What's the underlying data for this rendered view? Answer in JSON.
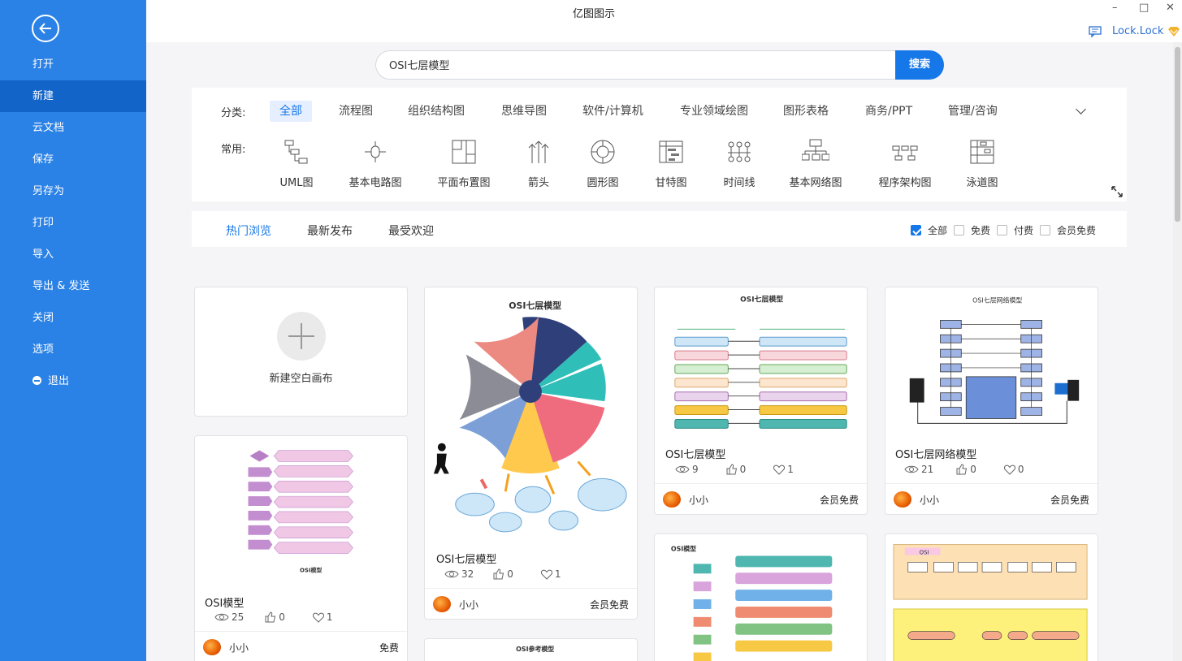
{
  "app_title": "亿图图示",
  "sidebar": {
    "items": [
      "打开",
      "新建",
      "云文档",
      "保存",
      "另存为",
      "打印",
      "导入",
      "导出 & 发送",
      "关闭",
      "选项",
      "退出"
    ],
    "active": "新建"
  },
  "window_controls": {
    "minimize": "–",
    "maximize": "□",
    "close": "✕"
  },
  "user": {
    "name": "Lock.Lock"
  },
  "search": {
    "value": "OSI七层模型",
    "button": "搜索"
  },
  "categories": {
    "label": "分类:",
    "items": [
      "全部",
      "流程图",
      "组织结构图",
      "思维导图",
      "软件/计算机",
      "专业领域绘图",
      "图形表格",
      "商务/PPT",
      "管理/咨询"
    ],
    "active": "全部"
  },
  "common": {
    "label": "常用:",
    "items": [
      "UML图",
      "基本电路图",
      "平面布置图",
      "箭头",
      "圆形图",
      "甘特图",
      "时间线",
      "基本网络图",
      "程序架构图",
      "泳道图"
    ]
  },
  "filter_tabs": [
    "热门浏览",
    "最新发布",
    "最受欢迎"
  ],
  "filter_checks": [
    {
      "label": "全部",
      "checked": true
    },
    {
      "label": "免费",
      "checked": false
    },
    {
      "label": "付费",
      "checked": false
    },
    {
      "label": "会员免费",
      "checked": false
    }
  ],
  "new_blank": {
    "label": "新建空白画布"
  },
  "cards": [
    {
      "title": "OSI七层模型",
      "views": "32",
      "likes": "0",
      "favorites": "1",
      "author": "小小",
      "price": "会员免费",
      "thumb_title": "OSI七层模型"
    },
    {
      "title": "OSI七层模型",
      "views": "9",
      "likes": "0",
      "favorites": "1",
      "author": "小小",
      "price": "会员免费",
      "thumb_title": "OSI七层模型"
    },
    {
      "title": "OSI七层网络模型",
      "views": "21",
      "likes": "0",
      "favorites": "0",
      "author": "小小",
      "price": "会员免费",
      "thumb_title": "OSI七层网络模型"
    },
    {
      "title": "OSI模型",
      "views": "25",
      "likes": "0",
      "favorites": "1",
      "author": "小小",
      "price": "免费",
      "thumb_title": "OSI模型"
    }
  ],
  "partial_cards": [
    {
      "thumb_title": "OSI参考模型"
    },
    {
      "thumb_title": "OSI模型"
    },
    {
      "thumb_title": "OSI"
    }
  ],
  "colors": {
    "sidebar": "#2b82e6",
    "sidebar_active": "#1264c8",
    "accent": "#1677e8"
  }
}
